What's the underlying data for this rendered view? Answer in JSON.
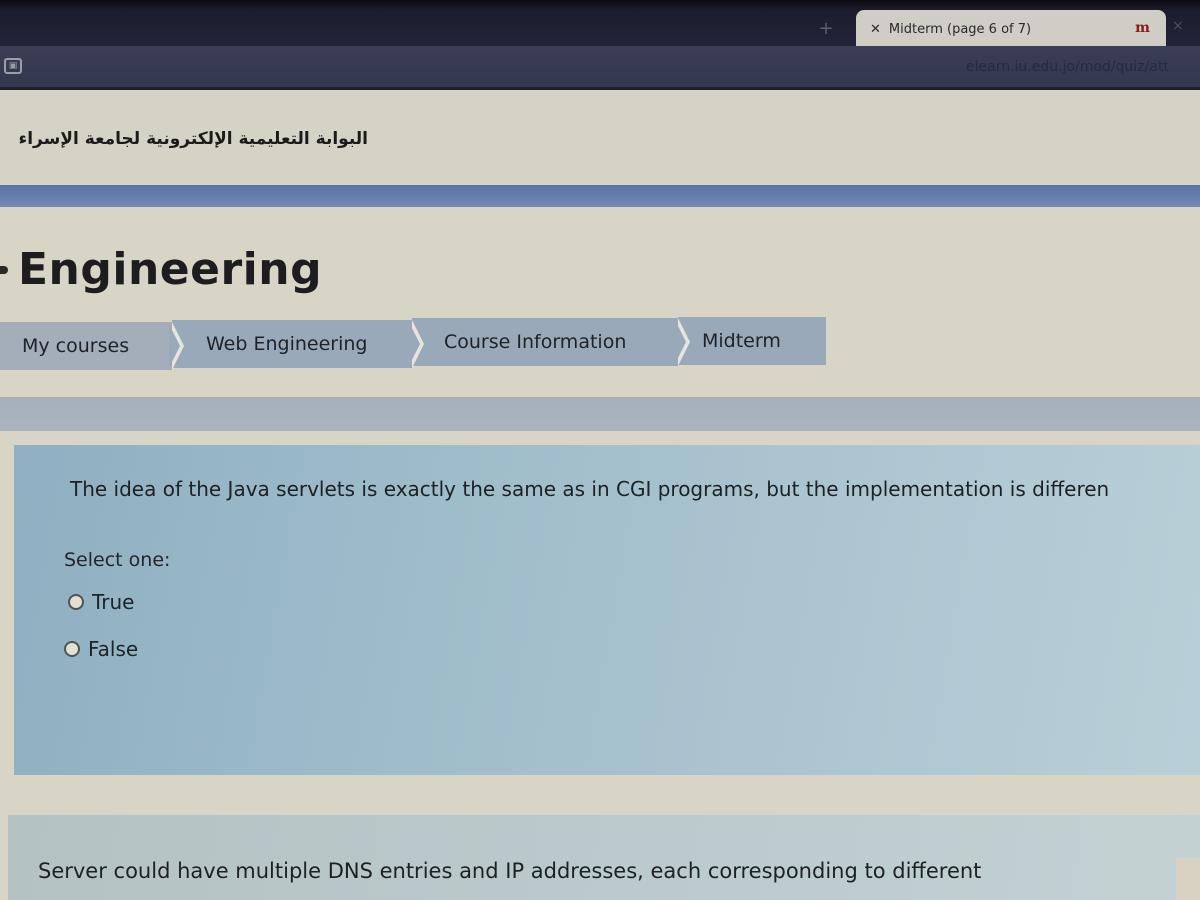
{
  "browser": {
    "new_tab_icon": "plus-icon",
    "active_tab": {
      "close_icon": "close-icon",
      "title": "Midterm (page 6 of 7)",
      "favicon_text": "m"
    },
    "next_tab_close": "×",
    "url": "elearn.iu.edu.jo/mod/quiz/att",
    "site_icon": "site-info-icon"
  },
  "site": {
    "portal_title": "البوابة التعليمية الإلكترونية لجامعة الإسراء"
  },
  "page": {
    "title": "Engineering"
  },
  "breadcrumb": [
    {
      "label": "My courses"
    },
    {
      "label": "Web Engineering"
    },
    {
      "label": "Course Information"
    },
    {
      "label": "Midterm"
    }
  ],
  "question1": {
    "text": "The idea of the Java servlets is exactly the same as in CGI programs, but the implementation is differen",
    "select_label": "Select one:",
    "options": [
      {
        "label": "True",
        "selected": false
      },
      {
        "label": "False",
        "selected": false
      }
    ]
  },
  "question2": {
    "text": "Server could have multiple DNS entries and IP addresses, each corresponding to different"
  }
}
